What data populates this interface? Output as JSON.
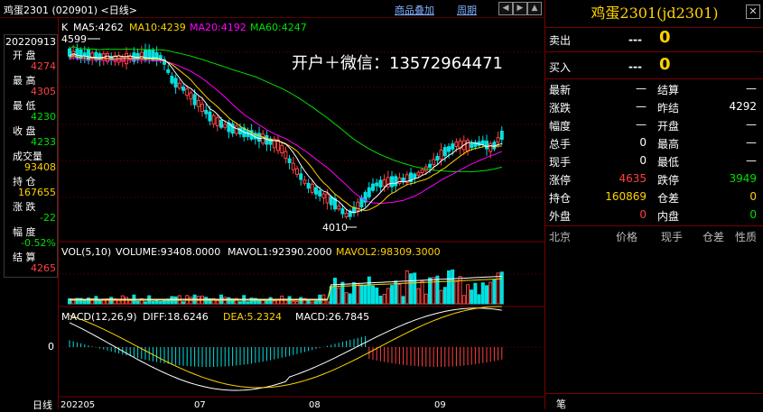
{
  "window": {
    "title": "鸡蛋2301 (020901) <日线>",
    "menu_overlay": "商品叠加",
    "menu_period": "周期",
    "nav_buttons": [
      "◀",
      "▶",
      "▲",
      "▼"
    ]
  },
  "left_panel": {
    "date": "20220913",
    "rows": [
      {
        "label": "开  盘",
        "value": "4274",
        "color": "#ff4040"
      },
      {
        "label": "最  高",
        "value": "4305",
        "color": "#ff4040"
      },
      {
        "label": "最  低",
        "value": "4230",
        "color": "#00e000"
      },
      {
        "label": "收  盘",
        "value": "4233",
        "color": "#00e000"
      },
      {
        "label": "成交量",
        "value": "93408",
        "color": "#ffd200"
      },
      {
        "label": "持  仓",
        "value": "167655",
        "color": "#ffd200"
      },
      {
        "label": "涨  跌",
        "value": "-22",
        "color": "#00e000"
      },
      {
        "label": "幅  度",
        "value": "-0.52%",
        "color": "#00e000"
      },
      {
        "label": "结  算",
        "value": "4265",
        "color": "#ff4040"
      }
    ]
  },
  "main_chart": {
    "k_label": "K",
    "ma5": "MA5:4262",
    "ma10": "MA10:4239",
    "ma20": "MA20:4192",
    "ma60": "MA60:4247",
    "colors": {
      "ma5": "#ffffff",
      "ma10": "#ffd200",
      "ma20": "#ff00ff",
      "ma60": "#00e000",
      "up": "#ff4040",
      "down": "#00e0e0"
    },
    "high_marker": "4599",
    "low_marker": "4010",
    "watermark": "开户＋微信：13572964471"
  },
  "vol_panel": {
    "label": "VOL(5,10)",
    "volume": "VOLUME:93408.0000",
    "mavol1": "MAVOL1:92390.2000",
    "mavol2": "MAVOL2:98309.3000"
  },
  "macd_panel": {
    "label": "MACD(12,26,9)",
    "diff": "DIFF:18.6246",
    "dea": "DEA:5.2324",
    "macd": "MACD:26.7845",
    "zero": "0"
  },
  "x_axis": {
    "period": "日线",
    "ticks": [
      "202205",
      "07",
      "08",
      "09"
    ]
  },
  "right_panel": {
    "title": "鸡蛋2301(jd2301)",
    "sell_label": "卖出",
    "sell_price": "---",
    "sell_qty": "0",
    "buy_label": "买入",
    "buy_price": "---",
    "buy_qty": "0",
    "quote_rows": [
      {
        "l1": "最新",
        "v1": "—",
        "c1": "#ffffff",
        "l2": "结算",
        "v2": "—",
        "c2": "#ffffff"
      },
      {
        "l1": "涨跌",
        "v1": "—",
        "c1": "#ffffff",
        "l2": "昨结",
        "v2": "4292",
        "c2": "#ffffff"
      },
      {
        "l1": "幅度",
        "v1": "—",
        "c1": "#ffffff",
        "l2": "开盘",
        "v2": "—",
        "c2": "#ffffff"
      },
      {
        "l1": "总手",
        "v1": "0",
        "c1": "#ffffff",
        "l2": "最高",
        "v2": "—",
        "c2": "#ffffff"
      },
      {
        "l1": "现手",
        "v1": "0",
        "c1": "#ffffff",
        "l2": "最低",
        "v2": "—",
        "c2": "#ffffff"
      },
      {
        "l1": "涨停",
        "v1": "4635",
        "c1": "#ff4040",
        "l2": "跌停",
        "v2": "3949",
        "c2": "#00e000"
      },
      {
        "l1": "持仓",
        "v1": "160869",
        "c1": "#ffd200",
        "l2": "仓差",
        "v2": "0",
        "c2": "#ffd200"
      },
      {
        "l1": "外盘",
        "v1": "0",
        "c1": "#ff4040",
        "l2": "内盘",
        "v2": "0",
        "c2": "#00e000"
      }
    ],
    "trade_headers": [
      "北京",
      "价格",
      "现手",
      "仓差",
      "性质"
    ],
    "bottom_char": "笔"
  }
}
